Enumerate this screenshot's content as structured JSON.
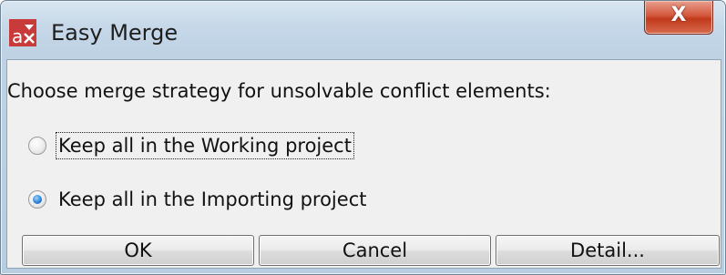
{
  "window": {
    "title": "Easy Merge",
    "close_label": "X"
  },
  "dialog": {
    "prompt": "Choose merge strategy for unsolvable conflict elements:",
    "options": [
      {
        "label": "Keep all in the Working project",
        "selected": false
      },
      {
        "label": "Keep all in the Importing project",
        "selected": true
      }
    ]
  },
  "buttons": {
    "ok": "OK",
    "cancel": "Cancel",
    "detail": "Detail..."
  },
  "icons": {
    "app": "astah-app-icon",
    "close": "close-icon"
  },
  "colors": {
    "close_button": "#c93a1c",
    "radio_selected": "#2e84d6",
    "app_icon": "#c93a3a"
  }
}
